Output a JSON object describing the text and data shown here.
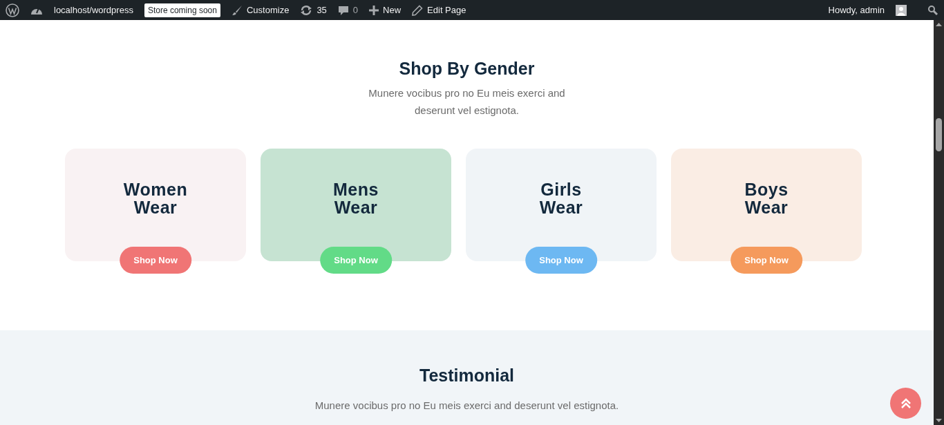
{
  "admin_bar": {
    "site": "localhost/wordpress",
    "store_badge": "Store coming soon",
    "customize": "Customize",
    "updates": "35",
    "comments": "0",
    "new": "New",
    "edit": "Edit Page",
    "greeting": "Howdy, admin"
  },
  "gender_section": {
    "title": "Shop By Gender",
    "subtitle": "Munere vocibus pro no Eu meis exerci and deserunt vel estignota.",
    "cards": [
      {
        "title_line1": "Women",
        "title_line2": "Wear",
        "card": {
          "color": "#f9f2f3"
        },
        "button": {
          "label": "Shop Now",
          "color": "#f07575"
        }
      },
      {
        "title_line1": "Mens",
        "title_line2": "Wear",
        "card": {
          "color": "#c6e3d2"
        },
        "button": {
          "label": "Shop Now",
          "color": "#62db87"
        }
      },
      {
        "title_line1": "Girls",
        "title_line2": "Wear",
        "card": {
          "color": "#f0f4f7"
        },
        "button": {
          "label": "Shop Now",
          "color": "#6db8f2"
        }
      },
      {
        "title_line1": "Boys",
        "title_line2": "Wear",
        "card": {
          "color": "#faede4"
        },
        "button": {
          "label": "Shop Now",
          "color": "#f59a5c"
        }
      }
    ]
  },
  "testimonial_section": {
    "title": "Testimonial",
    "subtitle": "Munere vocibus pro no Eu meis exerci and deserunt vel estignota."
  }
}
